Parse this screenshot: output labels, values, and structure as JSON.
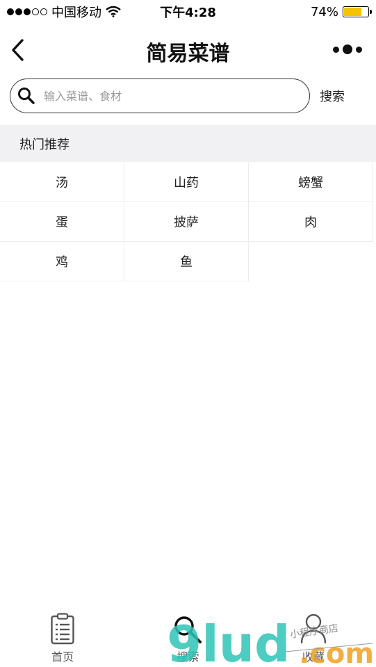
{
  "status_bar": {
    "carrier": "中国移动",
    "time": "下午4:28",
    "battery_percent": "74%",
    "battery_level": 0.74,
    "battery_color": "#f5c400"
  },
  "navbar": {
    "title": "简易菜谱",
    "back_icon": "chevron-left-icon",
    "more_icon": "more-dots-icon"
  },
  "search": {
    "placeholder": "输入菜谱、食材",
    "value": "",
    "button_label": "搜索"
  },
  "hot": {
    "title": "热门推荐",
    "items": [
      "汤",
      "山药",
      "螃蟹",
      "蛋",
      "披萨",
      "肉",
      "鸡",
      "鱼"
    ]
  },
  "tabs": [
    {
      "label": "首页",
      "icon": "clipboard-icon"
    },
    {
      "label": "搜索",
      "icon": "search-icon"
    },
    {
      "label": "收藏",
      "icon": "user-icon"
    }
  ],
  "watermark": {
    "text": "9lud",
    "suffix": ".com",
    "handwritten": "小程序商店"
  }
}
